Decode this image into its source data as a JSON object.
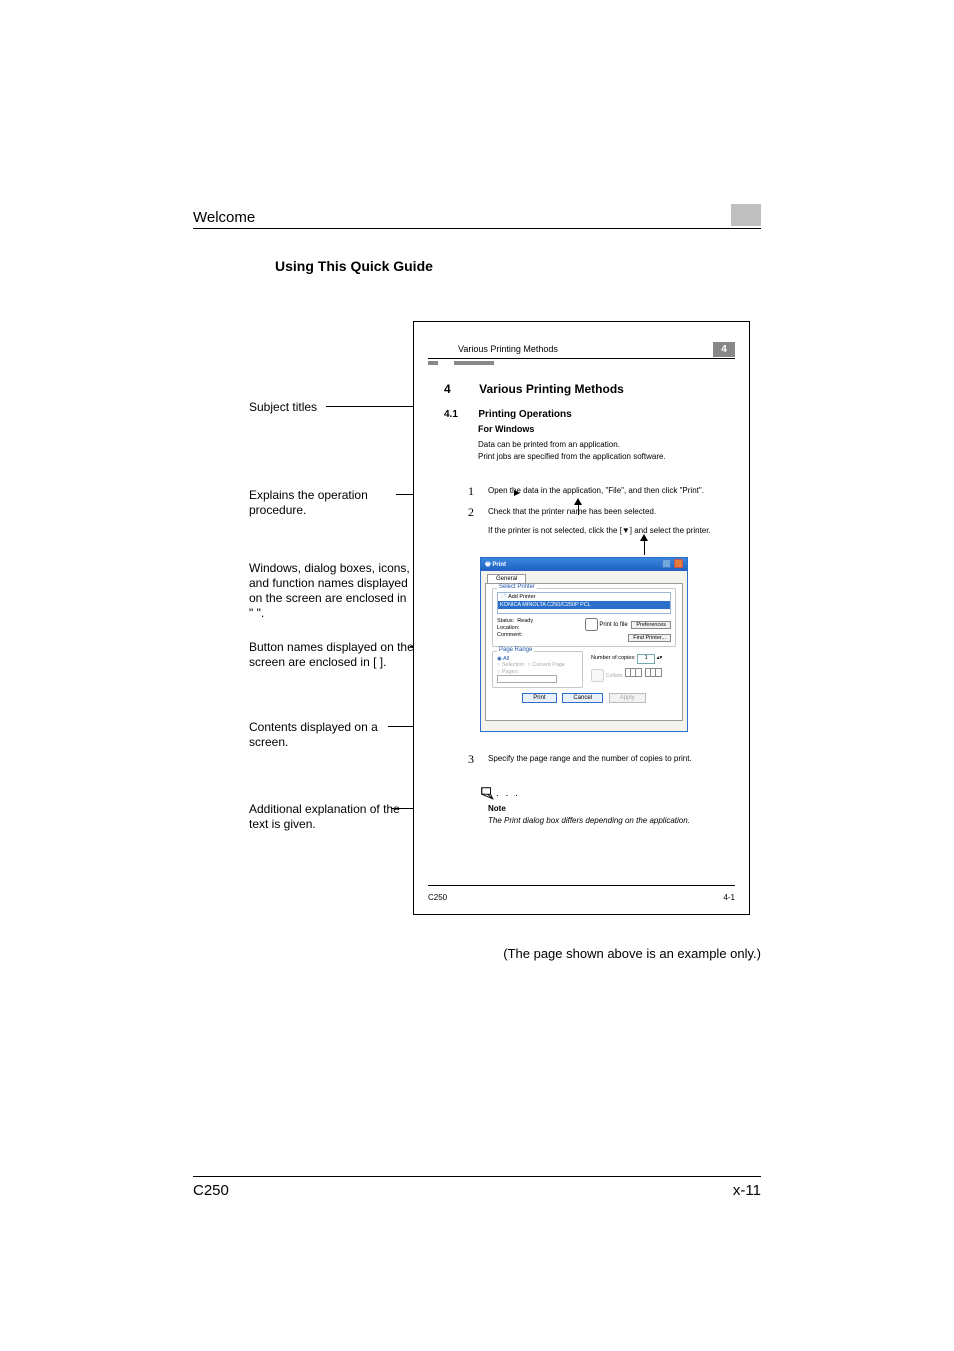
{
  "header": {
    "title": "Welcome"
  },
  "section": {
    "title": "Using This Quick Guide"
  },
  "callouts": {
    "subject_titles": "Subject titles",
    "explains": "Explains the operation procedure.",
    "windows_names": "Windows, dialog boxes, icons, and function names displayed on the screen are enclosed in \" \".",
    "button_names": "Button names displayed on the screen are enclosed in [  ].",
    "contents": "Contents displayed on a screen.",
    "additional": "Additional explanation of the text is given."
  },
  "mini": {
    "header_text": "Various Printing Methods",
    "header_num": "4",
    "chapter_num": "4",
    "chapter_title": "Various Printing Methods",
    "section_num": "4.1",
    "section_title": "Printing Operations",
    "subheading": "For Windows",
    "p1": "Data can be printed from an application.",
    "p2": "Print jobs are specified from the application software.",
    "step1_num": "1",
    "step1": "Open the data in the application, \"File\", and then click \"Print\".",
    "step2_num": "2",
    "step2": "Check that the printer name has been selected.",
    "cond": "If the printer is not selected, click the [▼] and select the printer.",
    "step3_num": "3",
    "step3": "Specify the page range and the number of copies to print.",
    "note_label": "Note",
    "note_text": "The Print dialog box differs depending on the application.",
    "footer_left": "C250",
    "footer_right": "4-1"
  },
  "dialog": {
    "title": "Print",
    "tab": "General",
    "group_select": "Select Printer",
    "add_printer": "Add Printer",
    "selected_printer": "KONICA MINOLTA C250/C250P PCL",
    "status_label": "Status:",
    "status_value": "Ready",
    "location_label": "Location:",
    "comment_label": "Comment:",
    "print_to_file": "Print to file",
    "preferences": "Preferences",
    "find_printer": "Find Printer...",
    "group_range": "Page Range",
    "range_all": "All",
    "range_selection": "Selection",
    "range_current": "Current Page",
    "range_pages": "Pages:",
    "copies_label": "Number of copies:",
    "copies_value": "1",
    "collate": "Collate",
    "btn_print": "Print",
    "btn_cancel": "Cancel",
    "btn_apply": "Apply"
  },
  "caption": "(The page shown above is an example only.)",
  "footer": {
    "left": "C250",
    "right": "x-11"
  }
}
